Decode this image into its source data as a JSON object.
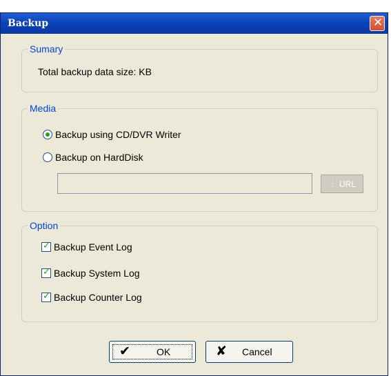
{
  "window": {
    "title": "Backup"
  },
  "summary": {
    "legend": "Sumary",
    "total_label": "Total backup data size: KB"
  },
  "media": {
    "legend": "Media",
    "options": [
      {
        "label": "Backup using CD/DVR Writer",
        "selected": true
      },
      {
        "label": "Backup on HardDisk",
        "selected": false
      }
    ],
    "path_value": "",
    "url_button": "URL"
  },
  "option": {
    "legend": "Option",
    "items": [
      {
        "label": "Backup Event Log",
        "checked": true
      },
      {
        "label": "Backup System Log",
        "checked": true
      },
      {
        "label": "Backup Counter Log",
        "checked": true
      }
    ]
  },
  "buttons": {
    "ok": "OK",
    "cancel": "Cancel"
  },
  "colors": {
    "title_bar": "#0b43b8",
    "legend_text": "#0046d5",
    "callout_line": "#23767d",
    "check_mark": "#21a121"
  }
}
